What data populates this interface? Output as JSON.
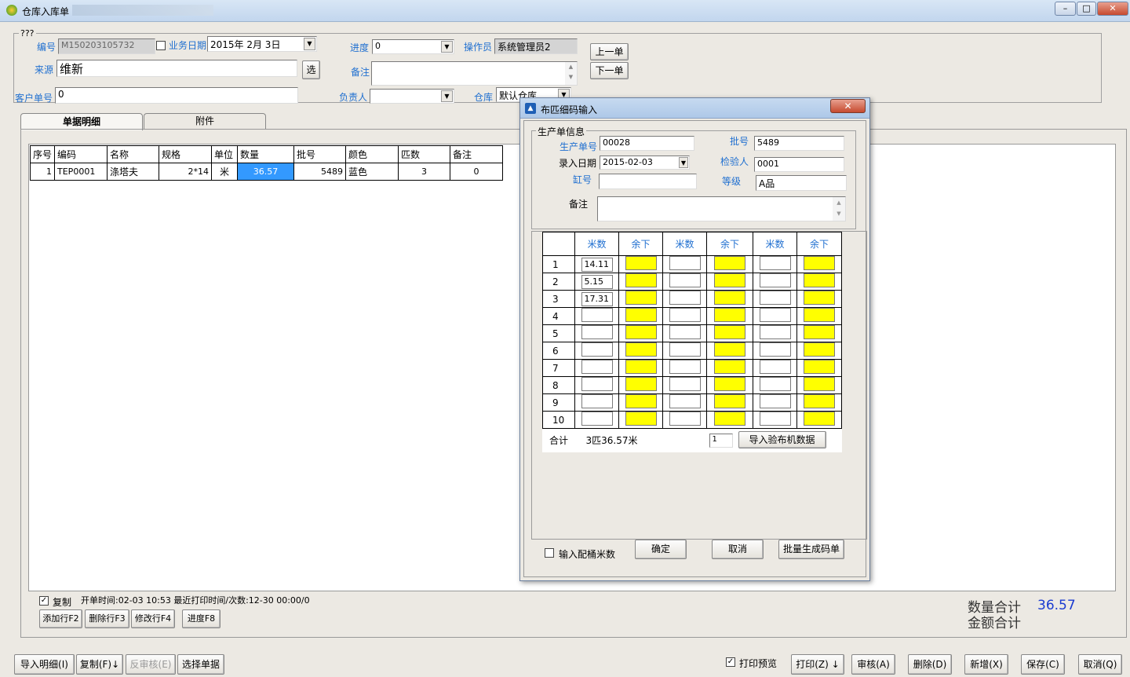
{
  "window": {
    "title": "仓库入库单",
    "blurred_title": "……"
  },
  "header": {
    "group_caption": "???",
    "code_label": "编号",
    "code_value": "M150203105732",
    "bizdate_label": "业务日期",
    "bizdate_value": "2015年 2月 3日",
    "source_label": "来源",
    "source_value": "维新",
    "select_btn": "选",
    "custno_label": "客户单号",
    "custno_value": "0",
    "progress_label": "进度",
    "progress_value": "0",
    "operator_label": "操作员",
    "operator_value": "系统管理员2",
    "remark_label": "备注",
    "remark_value": "",
    "owner_label": "负责人",
    "owner_value": "",
    "warehouse_label": "仓库",
    "warehouse_value": "默认仓库",
    "prev_btn": "上一单",
    "next_btn": "下一单"
  },
  "tabs": [
    {
      "label": "单据明细"
    },
    {
      "label": "附件"
    }
  ],
  "table": {
    "headers": [
      "序号",
      "编码",
      "名称",
      "规格",
      "单位",
      "数量",
      "批号",
      "颜色",
      "匹数",
      "备注"
    ],
    "rows": [
      [
        "1",
        "TEP0001",
        "涤塔夫",
        "2*14",
        "米",
        "36.57",
        "5489",
        "蓝色",
        "3",
        "0"
      ]
    ]
  },
  "footer": {
    "copy_label": "复制",
    "open_time": "开单时间:02-03 10:53 最近打印时间/次数:12-30 00:00/0",
    "add_row": "添加行F2",
    "del_row": "删除行F3",
    "edit_row": "修改行F4",
    "progress_btn": "进度F8",
    "qty_total_label": "数量合计",
    "qty_total_value": "36.57",
    "amount_total_label": "金额合计",
    "amount_total_value": ""
  },
  "bottom_bar": {
    "import_detail": "导入明细(I)",
    "copy": "复制(F)",
    "copy_arrow": "↓",
    "unaudit": "反审核(E)",
    "select_bill": "选择单据",
    "print_preview": "打印预览",
    "print": "打印(Z)",
    "print_arrow": "↓",
    "audit": "审核(A)",
    "delete": "删除(D)",
    "add": "新增(X)",
    "save": "保存(C)",
    "cancel": "取消(Q)"
  },
  "dialog": {
    "title": "布匹细码输入",
    "group_caption": "生产单信息",
    "prod_no_label": "生产单号",
    "prod_no_value": "00028",
    "batch_label": "批号",
    "batch_value": "5489",
    "date_label": "录入日期",
    "date_value": "2015-02-03",
    "inspector_label": "检验人",
    "inspector_value": "0001",
    "vat_label": "缸号",
    "vat_value": "",
    "grade_label": "等级",
    "grade_value": "A品",
    "remark_label": "备注",
    "remark_value": "",
    "col_headers": [
      "米数",
      "余下",
      "米数",
      "余下",
      "米数",
      "余下"
    ],
    "rows": [
      {
        "n": "1",
        "m1": "14.11",
        "m2": "",
        "m3": ""
      },
      {
        "n": "2",
        "m1": "5.15",
        "m2": "",
        "m3": ""
      },
      {
        "n": "3",
        "m1": "17.31",
        "m2": "",
        "m3": ""
      },
      {
        "n": "4",
        "m1": "",
        "m2": "",
        "m3": ""
      },
      {
        "n": "5",
        "m1": "",
        "m2": "",
        "m3": ""
      },
      {
        "n": "6",
        "m1": "",
        "m2": "",
        "m3": ""
      },
      {
        "n": "7",
        "m1": "",
        "m2": "",
        "m3": ""
      },
      {
        "n": "8",
        "m1": "",
        "m2": "",
        "m3": ""
      },
      {
        "n": "9",
        "m1": "",
        "m2": "",
        "m3": ""
      },
      {
        "n": "10",
        "m1": "",
        "m2": "",
        "m3": ""
      }
    ],
    "total_label": "合计",
    "total_value": "3匹36.57米",
    "count_value": "1",
    "import_btn": "导入验布机数据",
    "input_vat_label": "输入配桶米数",
    "ok_btn": "确定",
    "cancel_btn": "取消",
    "batch_btn": "批量生成码单",
    "close_icon": "close-icon",
    "colors": {
      "remain_fill": "#ffff00"
    }
  }
}
